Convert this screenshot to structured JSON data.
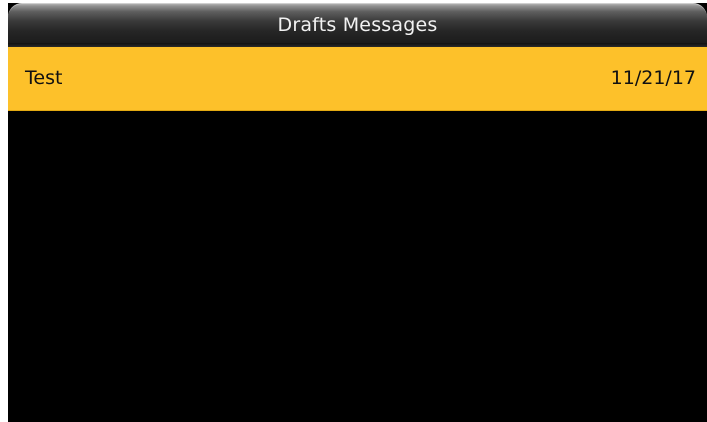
{
  "header": {
    "title": "Drafts Messages"
  },
  "messages": [
    {
      "subject": "Test",
      "date": "11/21/17",
      "selected": true
    }
  ],
  "colors": {
    "selection_highlight": "#fdc12a",
    "screen_background": "#000000",
    "title_text": "#f2f2f2"
  }
}
